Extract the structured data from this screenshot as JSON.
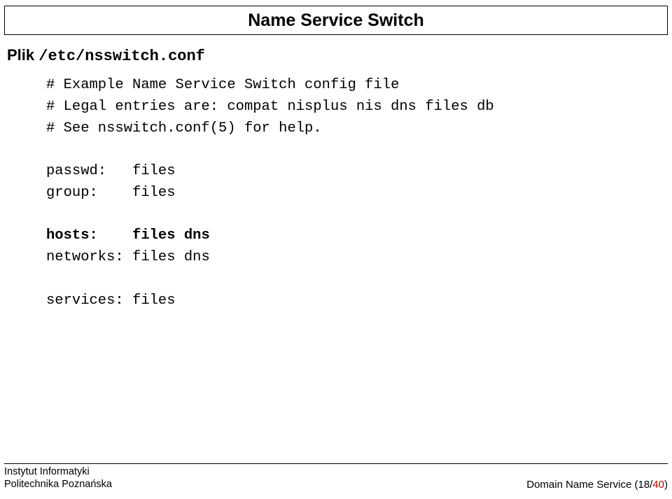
{
  "title": "Name Service Switch",
  "file_label": {
    "prefix": "Plik ",
    "path": "/etc/nsswitch.conf"
  },
  "code": {
    "c1": "# Example Name Service Switch config file",
    "c2": "# Legal entries are: compat nisplus nis dns files db",
    "c3": "# See nsswitch.conf(5) for help.",
    "entries": {
      "passwd": {
        "key": "passwd:   ",
        "val": "files"
      },
      "group": {
        "key": "group:    ",
        "val": "files"
      },
      "hosts": {
        "key": "hosts:    ",
        "val": "files dns"
      },
      "networks": {
        "key": "networks: ",
        "val": "files dns"
      },
      "services": {
        "key": "services: ",
        "val": "files"
      }
    }
  },
  "footer": {
    "org1": "Instytut Informatyki",
    "org2": "Politechnika Poznańska",
    "right_prefix": "Domain Name Service (",
    "page_current": "18",
    "page_sep": "/",
    "page_total": "40",
    "right_suffix": ")"
  }
}
